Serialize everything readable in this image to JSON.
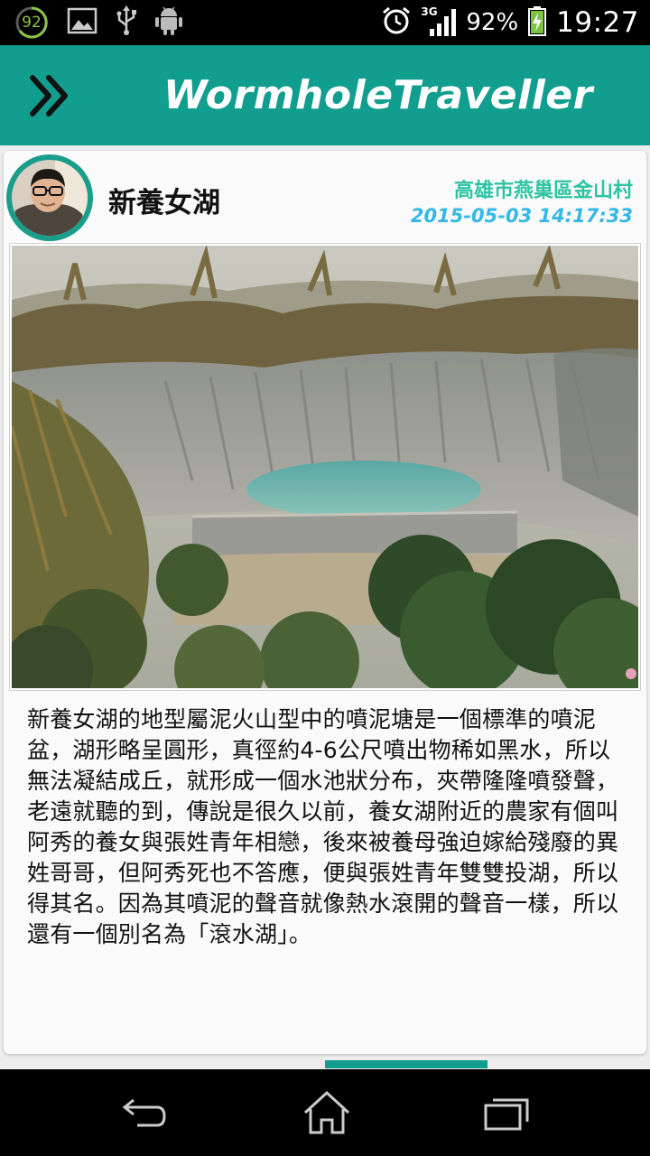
{
  "status_bar": {
    "notification_count": "92",
    "network_type": "3G",
    "battery_percent": "92%",
    "clock": "19:27",
    "icons": [
      "notification-badge-icon",
      "image-icon",
      "usb-icon",
      "android-icon",
      "alarm-icon",
      "signal-icon",
      "battery-charging-icon"
    ]
  },
  "app_bar": {
    "title": "WormholeTraveller",
    "menu_icon": "double-chevron-right-icon"
  },
  "post": {
    "place_name": "新養女湖",
    "location": "高雄市燕巢區金山村",
    "datetime": "2015-05-03 14:17:33",
    "description": "新養女湖的地型屬泥火山型中的噴泥塘是一個標準的噴泥盆，湖形略呈圓形，真徑約4-6公尺噴出物稀如黑水，所以無法凝結成丘，就形成一個水池狀分布，夾帶隆隆噴發聲，老遠就聽的到，傳說是很久以前，養女湖附近的農家有個叫阿秀的養女與張姓青年相戀，後來被養母強迫嫁給殘廢的異姓哥哥，但阿秀死也不答應，便與張姓青年雙雙投湖，所以得其名。因為其噴泥的聲音就像熱水滾開的聲音一樣，所以還有一個別名為「滾水湖」。"
  },
  "pager": {
    "active_page": 2,
    "total_pages": 4
  },
  "nav_bar": {
    "buttons": [
      "back-icon",
      "home-icon",
      "recent-apps-icon"
    ]
  },
  "colors": {
    "primary": "#129e8e",
    "location_text": "#2ec4a3",
    "datetime_text": "#35b8e6"
  }
}
